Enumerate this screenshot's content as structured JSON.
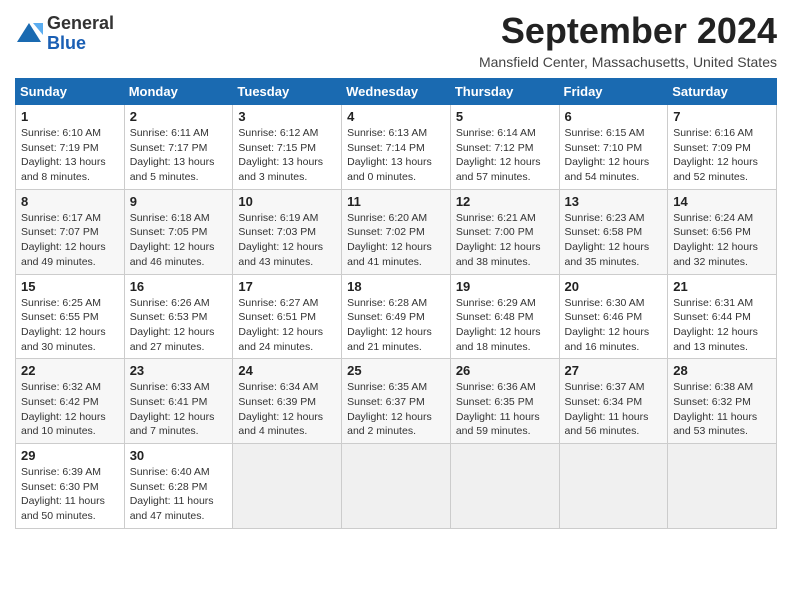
{
  "header": {
    "month_title": "September 2024",
    "location": "Mansfield Center, Massachusetts, United States",
    "logo_general": "General",
    "logo_blue": "Blue"
  },
  "weekdays": [
    "Sunday",
    "Monday",
    "Tuesday",
    "Wednesday",
    "Thursday",
    "Friday",
    "Saturday"
  ],
  "weeks": [
    [
      {
        "day": "1",
        "info": "Sunrise: 6:10 AM\nSunset: 7:19 PM\nDaylight: 13 hours\nand 8 minutes."
      },
      {
        "day": "2",
        "info": "Sunrise: 6:11 AM\nSunset: 7:17 PM\nDaylight: 13 hours\nand 5 minutes."
      },
      {
        "day": "3",
        "info": "Sunrise: 6:12 AM\nSunset: 7:15 PM\nDaylight: 13 hours\nand 3 minutes."
      },
      {
        "day": "4",
        "info": "Sunrise: 6:13 AM\nSunset: 7:14 PM\nDaylight: 13 hours\nand 0 minutes."
      },
      {
        "day": "5",
        "info": "Sunrise: 6:14 AM\nSunset: 7:12 PM\nDaylight: 12 hours\nand 57 minutes."
      },
      {
        "day": "6",
        "info": "Sunrise: 6:15 AM\nSunset: 7:10 PM\nDaylight: 12 hours\nand 54 minutes."
      },
      {
        "day": "7",
        "info": "Sunrise: 6:16 AM\nSunset: 7:09 PM\nDaylight: 12 hours\nand 52 minutes."
      }
    ],
    [
      {
        "day": "8",
        "info": "Sunrise: 6:17 AM\nSunset: 7:07 PM\nDaylight: 12 hours\nand 49 minutes."
      },
      {
        "day": "9",
        "info": "Sunrise: 6:18 AM\nSunset: 7:05 PM\nDaylight: 12 hours\nand 46 minutes."
      },
      {
        "day": "10",
        "info": "Sunrise: 6:19 AM\nSunset: 7:03 PM\nDaylight: 12 hours\nand 43 minutes."
      },
      {
        "day": "11",
        "info": "Sunrise: 6:20 AM\nSunset: 7:02 PM\nDaylight: 12 hours\nand 41 minutes."
      },
      {
        "day": "12",
        "info": "Sunrise: 6:21 AM\nSunset: 7:00 PM\nDaylight: 12 hours\nand 38 minutes."
      },
      {
        "day": "13",
        "info": "Sunrise: 6:23 AM\nSunset: 6:58 PM\nDaylight: 12 hours\nand 35 minutes."
      },
      {
        "day": "14",
        "info": "Sunrise: 6:24 AM\nSunset: 6:56 PM\nDaylight: 12 hours\nand 32 minutes."
      }
    ],
    [
      {
        "day": "15",
        "info": "Sunrise: 6:25 AM\nSunset: 6:55 PM\nDaylight: 12 hours\nand 30 minutes."
      },
      {
        "day": "16",
        "info": "Sunrise: 6:26 AM\nSunset: 6:53 PM\nDaylight: 12 hours\nand 27 minutes."
      },
      {
        "day": "17",
        "info": "Sunrise: 6:27 AM\nSunset: 6:51 PM\nDaylight: 12 hours\nand 24 minutes."
      },
      {
        "day": "18",
        "info": "Sunrise: 6:28 AM\nSunset: 6:49 PM\nDaylight: 12 hours\nand 21 minutes."
      },
      {
        "day": "19",
        "info": "Sunrise: 6:29 AM\nSunset: 6:48 PM\nDaylight: 12 hours\nand 18 minutes."
      },
      {
        "day": "20",
        "info": "Sunrise: 6:30 AM\nSunset: 6:46 PM\nDaylight: 12 hours\nand 16 minutes."
      },
      {
        "day": "21",
        "info": "Sunrise: 6:31 AM\nSunset: 6:44 PM\nDaylight: 12 hours\nand 13 minutes."
      }
    ],
    [
      {
        "day": "22",
        "info": "Sunrise: 6:32 AM\nSunset: 6:42 PM\nDaylight: 12 hours\nand 10 minutes."
      },
      {
        "day": "23",
        "info": "Sunrise: 6:33 AM\nSunset: 6:41 PM\nDaylight: 12 hours\nand 7 minutes."
      },
      {
        "day": "24",
        "info": "Sunrise: 6:34 AM\nSunset: 6:39 PM\nDaylight: 12 hours\nand 4 minutes."
      },
      {
        "day": "25",
        "info": "Sunrise: 6:35 AM\nSunset: 6:37 PM\nDaylight: 12 hours\nand 2 minutes."
      },
      {
        "day": "26",
        "info": "Sunrise: 6:36 AM\nSunset: 6:35 PM\nDaylight: 11 hours\nand 59 minutes."
      },
      {
        "day": "27",
        "info": "Sunrise: 6:37 AM\nSunset: 6:34 PM\nDaylight: 11 hours\nand 56 minutes."
      },
      {
        "day": "28",
        "info": "Sunrise: 6:38 AM\nSunset: 6:32 PM\nDaylight: 11 hours\nand 53 minutes."
      }
    ],
    [
      {
        "day": "29",
        "info": "Sunrise: 6:39 AM\nSunset: 6:30 PM\nDaylight: 11 hours\nand 50 minutes."
      },
      {
        "day": "30",
        "info": "Sunrise: 6:40 AM\nSunset: 6:28 PM\nDaylight: 11 hours\nand 47 minutes."
      },
      {
        "day": "",
        "info": ""
      },
      {
        "day": "",
        "info": ""
      },
      {
        "day": "",
        "info": ""
      },
      {
        "day": "",
        "info": ""
      },
      {
        "day": "",
        "info": ""
      }
    ]
  ]
}
